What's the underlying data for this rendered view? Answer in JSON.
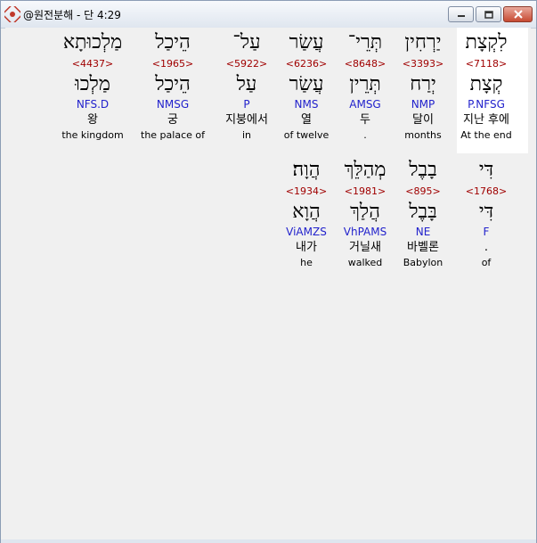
{
  "window": {
    "title": "@원전분해 - 단 4:29",
    "buttons": {
      "minimize": "minimize",
      "maximize": "maximize",
      "close": "close"
    }
  },
  "rows": [
    {
      "words": [
        {
          "heb": "לִקְצָת",
          "strong": "<7118>",
          "lemma": "קְצָת",
          "morph": "P.NFSG",
          "kor": "지난 후에",
          "eng": "At the end",
          "highlighted": true
        },
        {
          "heb": "יַרְחִין",
          "strong": "<3393>",
          "lemma": "יְרַח",
          "morph": "NMP",
          "kor": "달이",
          "eng": "months"
        },
        {
          "heb": "תְּרֵי־",
          "strong": "<8648>",
          "lemma": "תְּרֵין",
          "morph": "AMSG",
          "kor": "두",
          "eng": "."
        },
        {
          "heb": "עֲשַׂר",
          "strong": "<6236>",
          "lemma": "עֲשַׂר",
          "morph": "NMS",
          "kor": "열",
          "eng": "of twelve"
        },
        {
          "heb": "עַל־",
          "strong": "<5922>",
          "lemma": "עַל",
          "morph": "P",
          "kor": "지붕에서",
          "eng": "in"
        },
        {
          "heb": "הֵיכַל",
          "strong": "<1965>",
          "lemma": "הֵיכַל",
          "morph": "NMSG",
          "kor": "궁",
          "eng": "the palace of"
        },
        {
          "heb": "מַלְכוּתָא",
          "strong": "<4437>",
          "lemma": "מַלְכוּ",
          "morph": "NFS.D",
          "kor": "왕",
          "eng": "the kingdom"
        }
      ]
    },
    {
      "words": [
        {
          "heb": "דִּי",
          "strong": "<1768>",
          "lemma": "דִּי",
          "morph": "F",
          "kor": ".",
          "eng": "of"
        },
        {
          "heb": "בָבֶל",
          "strong": "<895>",
          "lemma": "בָּבֶל",
          "morph": "NE",
          "kor": "바벨론",
          "eng": "Babylon"
        },
        {
          "heb": "מְהַלֵּךְ",
          "strong": "<1981>",
          "lemma": "הֲלַךְ",
          "morph": "VhPAMS",
          "kor": "거닐새",
          "eng": "walked"
        },
        {
          "heb": "הֲוָה׃",
          "strong": "<1934>",
          "lemma": "הֲוָא",
          "morph": "ViAMZS",
          "kor": "내가",
          "eng": "he"
        }
      ]
    }
  ]
}
